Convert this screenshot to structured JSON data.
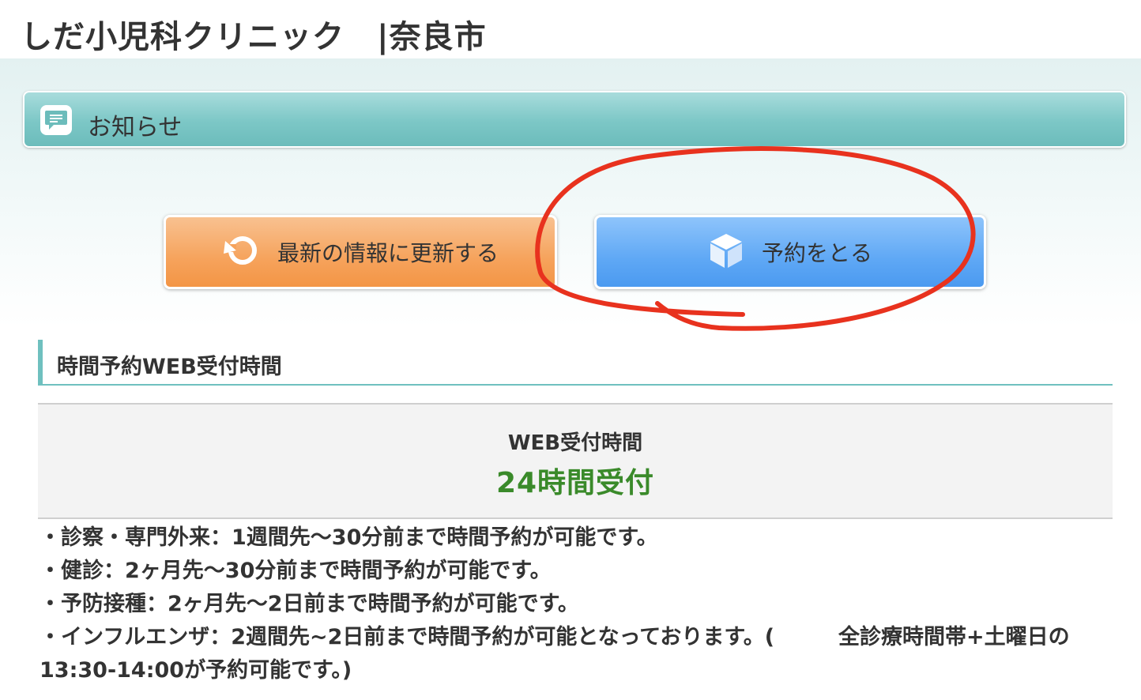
{
  "header": {
    "site_title": "しだ小児科クリニック　|奈良市"
  },
  "notice": {
    "icon": "chat-bubble-icon",
    "label": "お知らせ"
  },
  "buttons": {
    "refresh": {
      "label": "最新の情報に更新する",
      "icon": "refresh-icon",
      "color": "#f6a35c"
    },
    "reserve": {
      "label": "予約をとる",
      "icon": "cube-icon",
      "color": "#5fa8f5"
    }
  },
  "section": {
    "title": "時間予約WEB受付時間"
  },
  "hours": {
    "label": "WEB受付時間",
    "value": "24時間受付",
    "value_color": "#3a8a2a"
  },
  "notes": [
    "・診察・専門外来：1週間先〜30分前まで時間予約が可能です。",
    "・健診：2ヶ月先〜30分前まで時間予約が可能です。",
    "・予防接種：2ヶ月先〜2日前まで時間予約が可能です。",
    "・インフルエンザ：2週間先~2日前まで時間予約が可能となっております。(　　　全診療時間帯+土曜日の",
    "13:30-14:00が予約可能です。)"
  ],
  "annotation": {
    "color": "#e8321e"
  }
}
